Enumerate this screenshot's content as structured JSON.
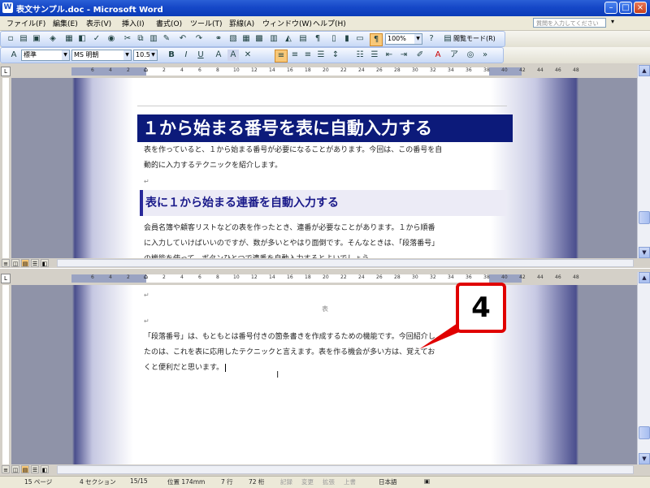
{
  "window": {
    "title": "表文サンプル.doc - Microsoft Word",
    "app_icon": "W"
  },
  "menu": {
    "items": [
      "ファイル(F)",
      "編集(E)",
      "表示(V)",
      "挿入(I)",
      "書式(O)",
      "ツール(T)",
      "罫線(A)",
      "ウィンドウ(W)",
      "ヘルプ(H)"
    ],
    "help_placeholder": "質問を入力してください"
  },
  "toolbar1": {
    "zoom": "100%",
    "reading_mode": "閲覧モード(R)"
  },
  "toolbar2": {
    "style": "標準",
    "font": "MS 明朝",
    "size": "10.5",
    "bold": "B",
    "italic": "I",
    "underline": "U",
    "font_color_letter": "A"
  },
  "ruler": {
    "numbers": [
      "6",
      "4",
      "2",
      "2",
      "4",
      "6",
      "8",
      "10",
      "12",
      "14",
      "16",
      "18",
      "20",
      "22",
      "24",
      "26",
      "28",
      "30",
      "32",
      "34",
      "36",
      "38",
      "40",
      "42",
      "44",
      "46",
      "48"
    ]
  },
  "doc_top": {
    "heading1": "１から始まる番号を表に自動入力する",
    "para1_line1": "表を作っていると、１から始まる番号が必要になることがあります。今回は、この番号を自",
    "para1_line2": "動的に入力するテクニックを紹介します。",
    "heading2": "表に１から始まる連番を自動入力する",
    "para2_line1": "会員名簿や顧客リストなどの表を作ったとき、連番が必要なことがあります。１から順番",
    "para2_line2": "に入力していけばいいのですが、数が多いとやはり面倒です。そんなときは、「段落番号」",
    "para2_line3": "の機能を使って、ボタンひとつで連番を自動入力するとよいでしょう。"
  },
  "doc_bottom": {
    "centered": "表",
    "para_line1": "「段落番号」は、もともとは番号付きの箇条書きを作成するための機能です。今回紹介し",
    "para_line2": "たのは、これを表に応用したテクニックと言えます。表を作る機会が多い方は、覚えてお",
    "para_line3": "くと便利だと思います。"
  },
  "callout": {
    "number": "4",
    "color": "#e00000"
  },
  "status": {
    "page": "15 ページ",
    "section": "4 セクション",
    "pages": "15/15",
    "position": "位置 174mm",
    "line": "7 行",
    "column": "72 桁",
    "rec": "記録",
    "trk": "変更",
    "ext": "拡張",
    "ovr": "上書",
    "language": "日本語"
  },
  "colors": {
    "heading_bar": "#0c1a7a",
    "title_bar": "#1648c8",
    "callout_border": "#e00000"
  }
}
